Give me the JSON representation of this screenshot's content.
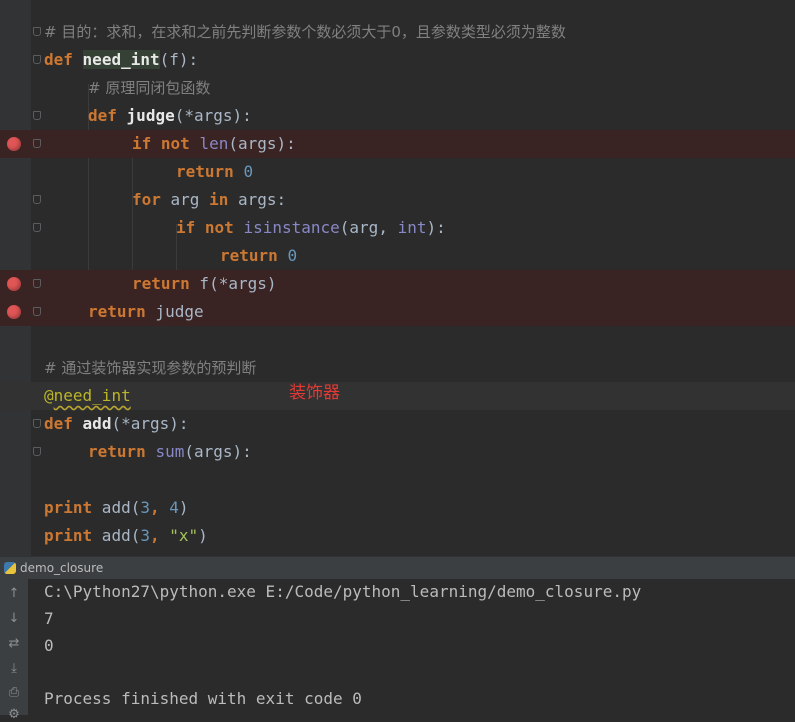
{
  "editor": {
    "comment_purpose": "# 目的：求和，在求和之前先判断参数个数必须大于0，且参数类型必须为整数",
    "kw_def": "def",
    "kw_if": "if",
    "kw_not": "not",
    "kw_return": "return",
    "kw_for": "for",
    "kw_in": "in",
    "kw_print": "print",
    "fn_need_int": "need_int",
    "fn_judge": "judge",
    "fn_add": "add",
    "bi_len": "len",
    "bi_isinstance": "isinstance",
    "bi_int": "int",
    "bi_sum": "sum",
    "param_f": "(f):",
    "param_args_def": "(*args):",
    "args_call": "(args):",
    "comment_closure": "# 原理同闭包函数",
    "zero": "0",
    "for_var": " arg ",
    "args_word": " args:",
    "isinstance_open": "(arg, ",
    "isinstance_close": "):",
    "return_f": " f(*args)",
    "return_judge": " judge",
    "comment_decorator": "# 通过装饰器实现参数的预判断",
    "at_sign": "@",
    "print_add": " add(",
    "num_3": "3",
    "num_4": "4",
    "comma": ", ",
    "close_paren": ")",
    "str_x": "\"x\"",
    "annotation": "装饰器"
  },
  "run_panel": {
    "tab_title": "demo_closure",
    "output": [
      "C:\\Python27\\python.exe E:/Code/python_learning/demo_closure.py",
      "7",
      "0",
      "",
      "Process finished with exit code 0"
    ]
  },
  "colors": {
    "background": "#2b2b2b",
    "keyword": "#cc7832",
    "breakpoint": "#e05555",
    "annotation": "#e53935"
  },
  "icons": [
    "breakpoint-icon",
    "python-file-icon",
    "rerun-up-icon",
    "rerun-down-icon",
    "soft-wrap-icon",
    "scroll-end-icon",
    "print-icon",
    "settings-icon"
  ]
}
